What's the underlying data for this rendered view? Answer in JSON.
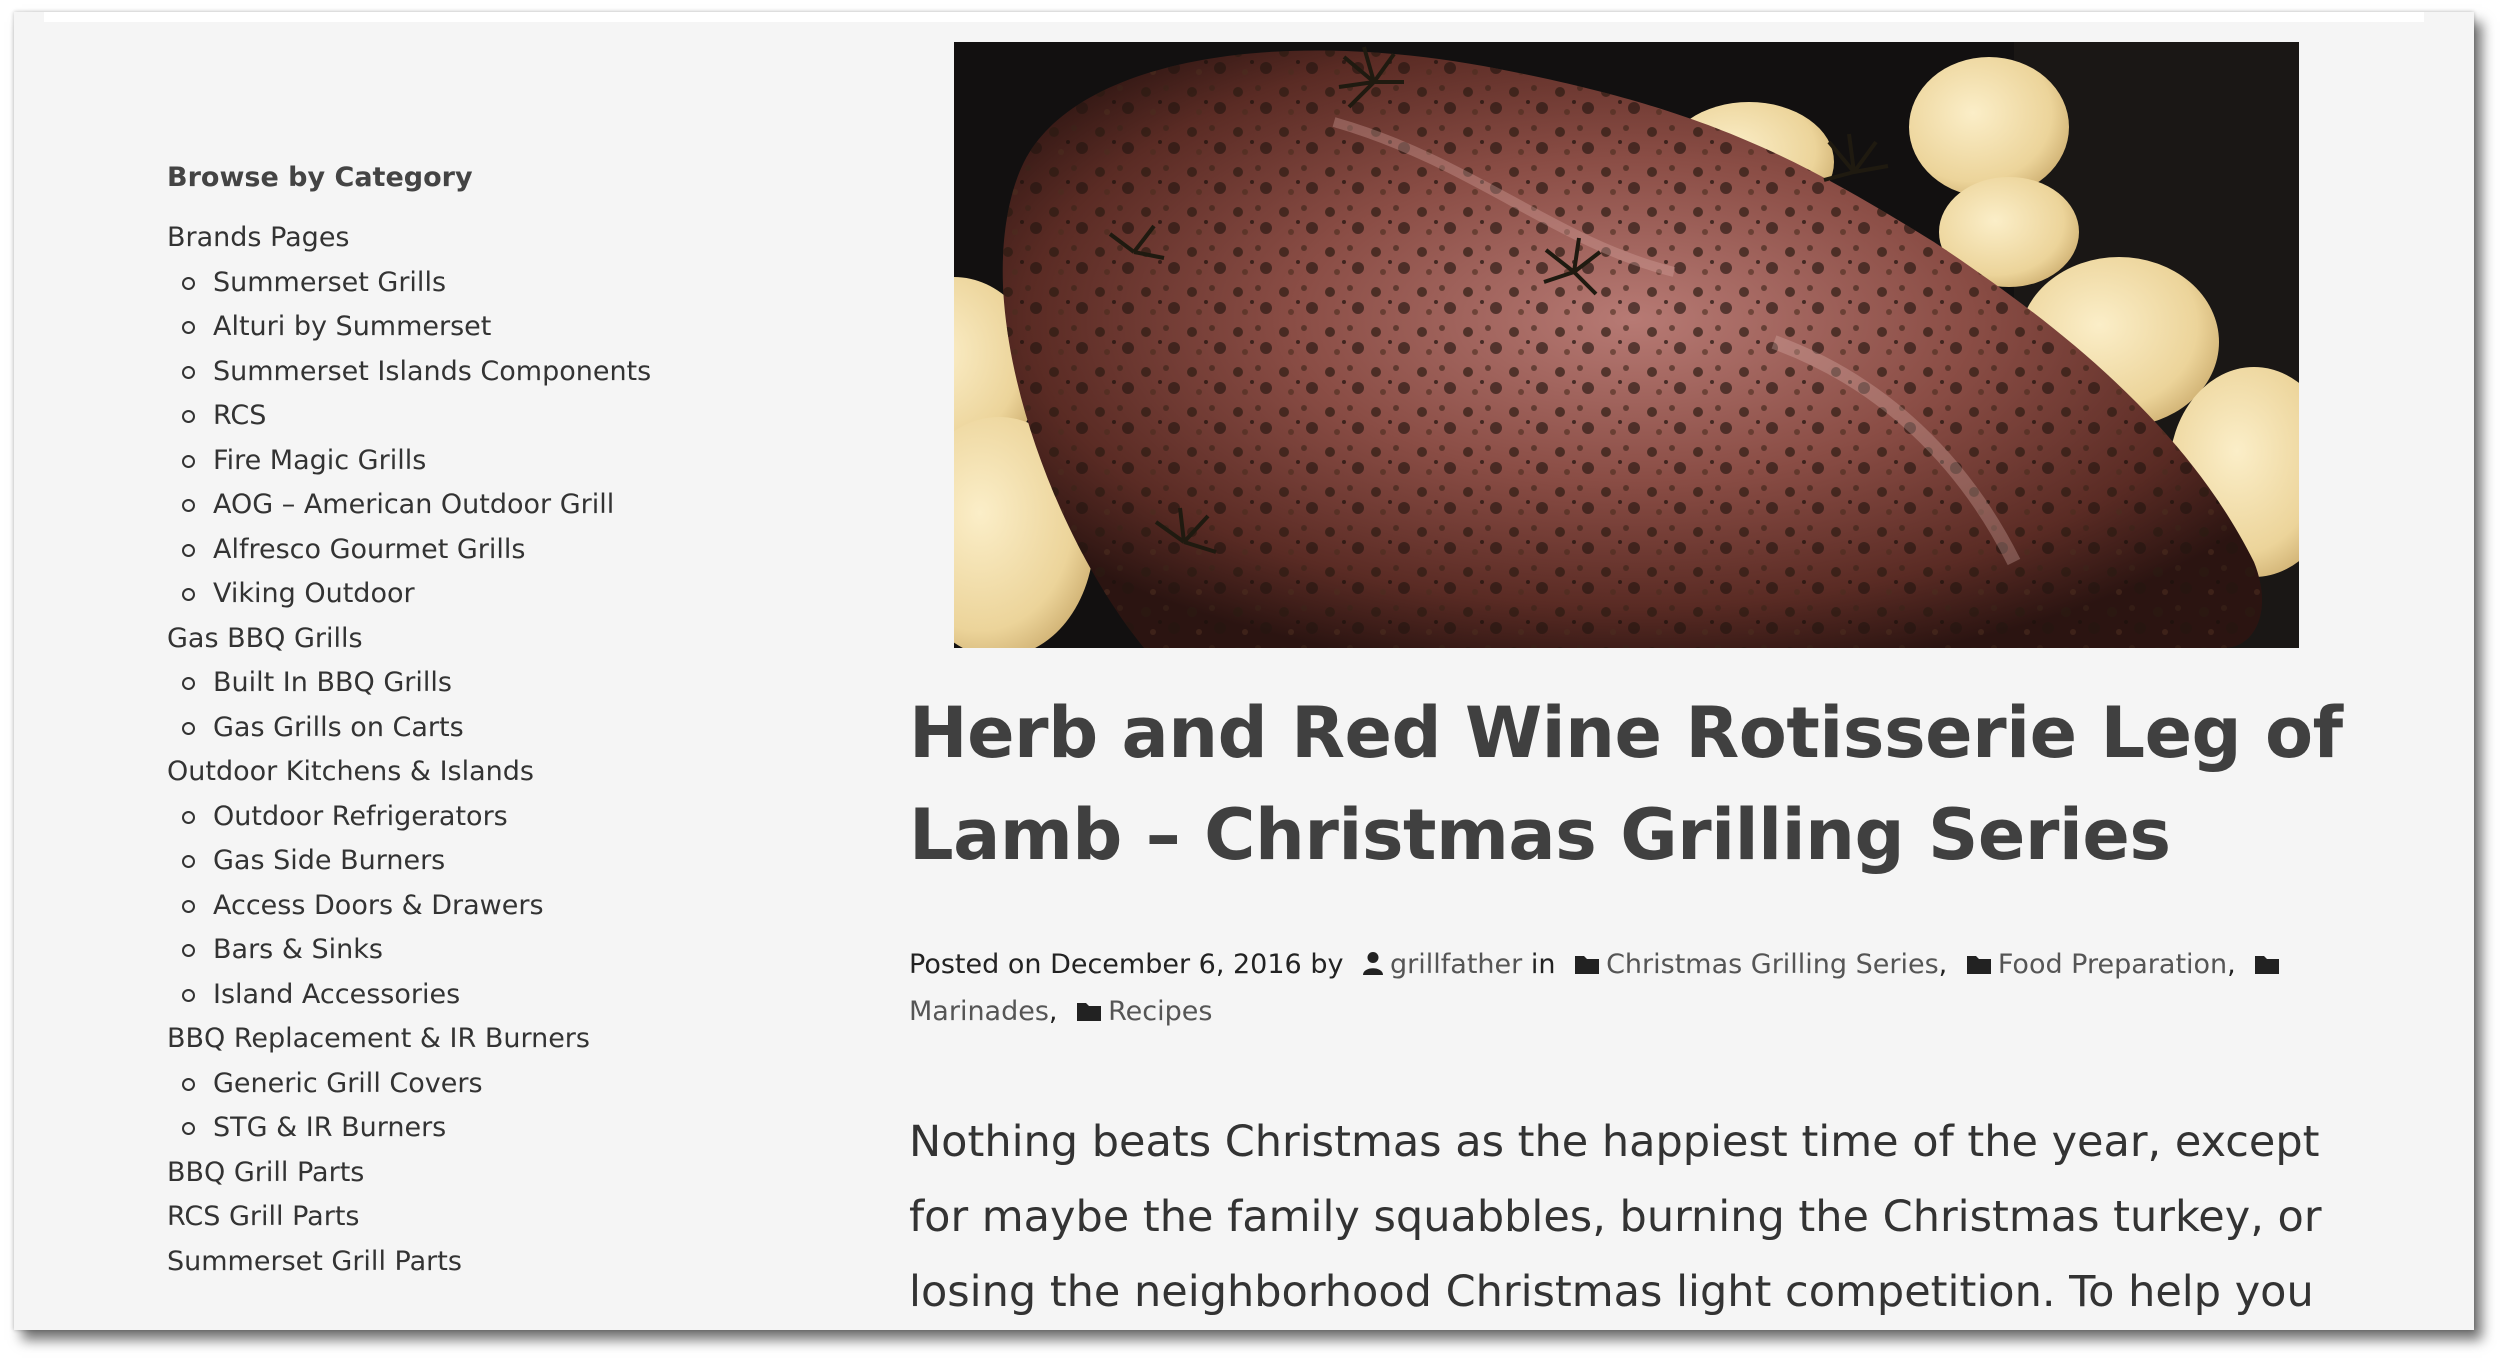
{
  "sidebar": {
    "heading": "Browse by Category",
    "categories": [
      {
        "label": "Brands Pages",
        "children": [
          "Summerset Grills",
          "Alturi by Summerset",
          "Summerset Islands Components",
          "RCS",
          "Fire Magic Grills",
          "AOG – American Outdoor Grill",
          "Alfresco Gourmet Grills",
          "Viking Outdoor"
        ]
      },
      {
        "label": "Gas BBQ Grills",
        "children": [
          "Built In BBQ Grills",
          "Gas Grills on Carts"
        ]
      },
      {
        "label": "Outdoor Kitchens & Islands",
        "children": [
          "Outdoor Refrigerators",
          "Gas Side Burners",
          "Access Doors & Drawers",
          "Bars & Sinks",
          "Island Accessories"
        ]
      },
      {
        "label": "BBQ Replacement & IR Burners",
        "children": [
          "Generic Grill Covers",
          "STG & IR Burners"
        ]
      },
      {
        "label": "BBQ Grill Parts",
        "children": []
      },
      {
        "label": "RCS Grill Parts",
        "children": []
      },
      {
        "label": "Summerset Grill Parts",
        "children": []
      }
    ]
  },
  "post": {
    "title": "Herb and Red Wine Rotisserie Leg of Lamb – Christmas Grilling Series",
    "meta": {
      "posted_on": "Posted on",
      "date": "December 6, 2016",
      "by": "by",
      "author": "grillfather",
      "in": "in",
      "categories": [
        "Christmas Grilling Series",
        "Food Preparation",
        "Marinades",
        "Recipes"
      ],
      "separator": ","
    },
    "excerpt": "Nothing beats Christmas as the happiest time of the year, except for maybe the family squabbles, burning the Christmas turkey, or losing the neighborhood Christmas light competition. To help you avoid one",
    "image_icon": "roast-leg-of-lamb-image"
  },
  "colors": {
    "page_bg": "#f5f5f5",
    "title": "#404040",
    "text": "#333333"
  }
}
